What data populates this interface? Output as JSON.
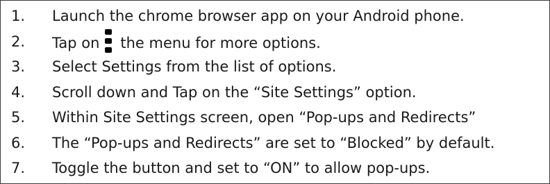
{
  "steps": [
    {
      "number": "1.",
      "text": "Launch the chrome browser app on your Android phone."
    },
    {
      "number": "2.",
      "before": "Tap on",
      "icon": "kebab-menu-icon",
      "after": "the menu for more options."
    },
    {
      "number": "3.",
      "text": "Select Settings from the list of options."
    },
    {
      "number": "4.",
      "text": "Scroll down and Tap on the “Site Settings” option."
    },
    {
      "number": "5.",
      "text": "Within Site Settings screen, open “Pop-ups and Redirects”"
    },
    {
      "number": "6.",
      "text": "The “Pop-ups and Redirects” are set to “Blocked” by default."
    },
    {
      "number": "7.",
      "text": "Toggle the button and set to “ON” to allow pop-ups."
    }
  ]
}
